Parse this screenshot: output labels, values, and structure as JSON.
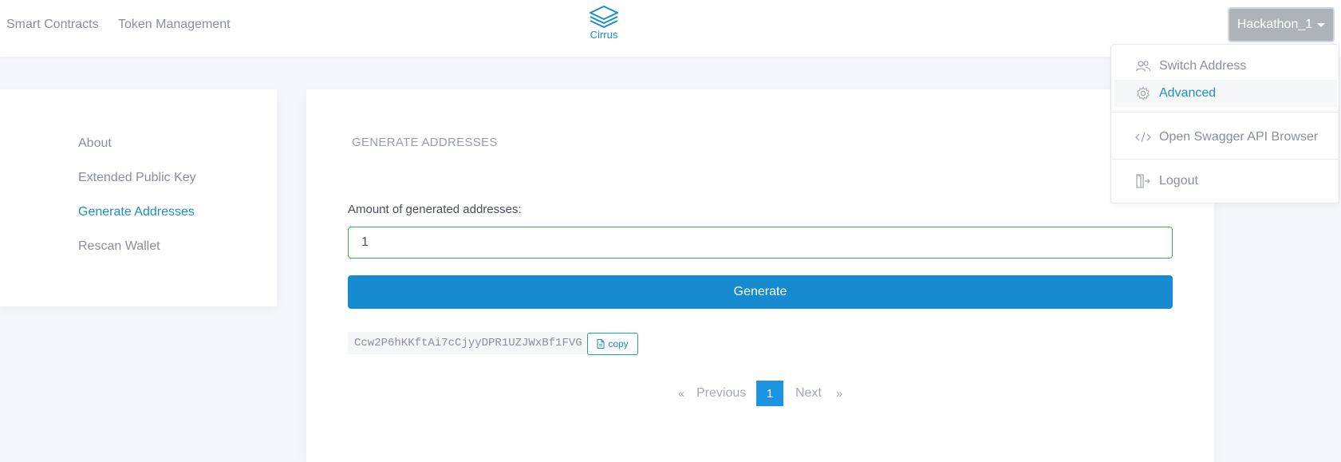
{
  "header": {
    "nav": [
      {
        "label": "Smart Contracts"
      },
      {
        "label": "Token Management"
      }
    ],
    "logo_text": "Cirrus",
    "account_label": "Hackathon_1"
  },
  "dropdown": {
    "items": [
      {
        "label": "Switch Address",
        "icon": "users-icon"
      },
      {
        "label": "Advanced",
        "icon": "gear-icon"
      },
      {
        "label": "Open Swagger API Browser",
        "icon": "code-icon"
      },
      {
        "label": "Logout",
        "icon": "logout-icon"
      }
    ]
  },
  "sidebar": {
    "items": [
      {
        "label": "About"
      },
      {
        "label": "Extended Public Key"
      },
      {
        "label": "Generate Addresses"
      },
      {
        "label": "Rescan Wallet"
      }
    ]
  },
  "main": {
    "title": "GENERATE ADDRESSES",
    "amount_label": "Amount of generated addresses:",
    "amount_value": "1",
    "generate_label": "Generate",
    "address": "Ccw2P6hKKftAi7cCjyyDPR1UZJWxBf1FVG",
    "copy_label": "copy",
    "pager": {
      "laquo": "«",
      "previous": "Previous",
      "current": "1",
      "next": "Next",
      "raquo": "»"
    }
  },
  "colors": {
    "accent": "#1b8ec8",
    "button": "#168bd0",
    "input_border": "#3fae49",
    "account_button": "#aeb3b9"
  }
}
